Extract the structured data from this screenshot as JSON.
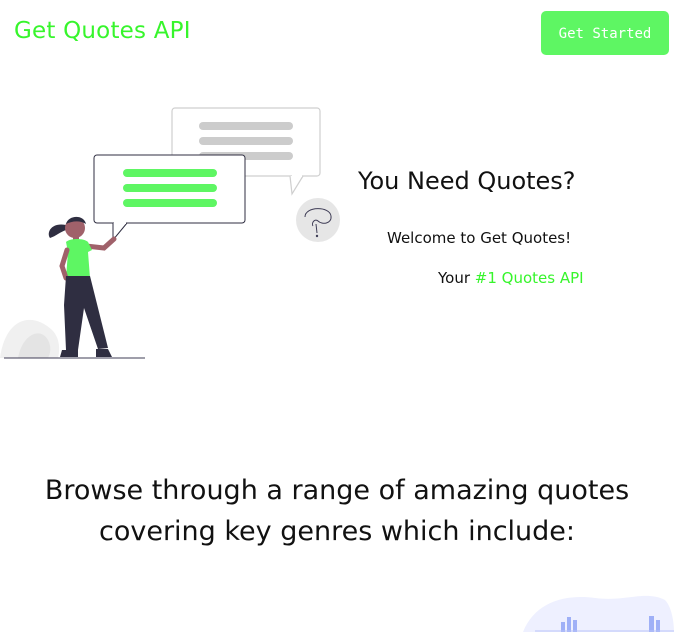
{
  "header": {
    "brand": "Get Quotes API",
    "cta_label": "Get Started"
  },
  "hero": {
    "title": "You Need Quotes?",
    "welcome": "Welcome to Get Quotes!",
    "tagline_prefix": "Your ",
    "tagline_accent": "#1 Quotes API"
  },
  "browse": {
    "heading_line1": "Browse through a range of amazing quotes",
    "heading_line2": "covering key genres which include:"
  },
  "colors": {
    "accent": "#37f52c",
    "button": "#5ef663",
    "illustration_dark": "#2f2e41"
  }
}
